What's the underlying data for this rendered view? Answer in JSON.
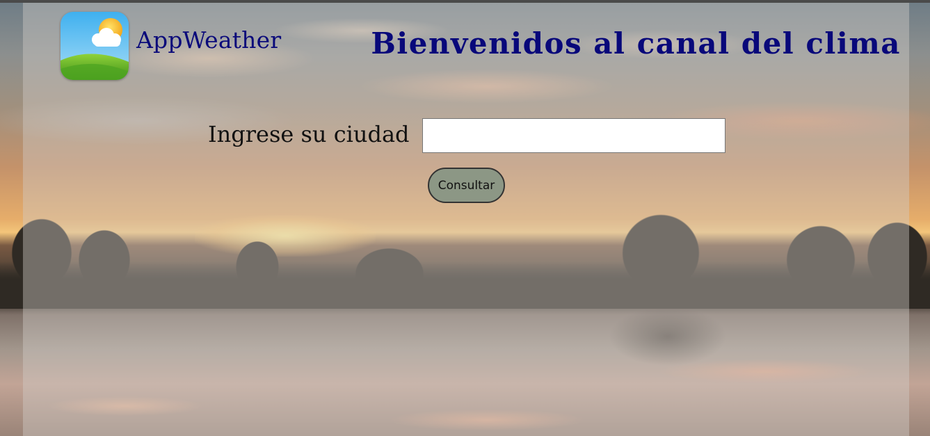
{
  "header": {
    "app_name": "AppWeather",
    "welcome_title": "Bienvenidos al canal del clima",
    "logo_icon": "weather-sun-cloud-icon"
  },
  "form": {
    "city_label": "Ingrese su ciudad",
    "city_value": "",
    "city_placeholder": "",
    "submit_label": "Consultar"
  },
  "colors": {
    "title_blue": "#08087a",
    "button_fill": "#8c9785",
    "panel_overlay": "rgba(210,205,200,0.42)"
  }
}
